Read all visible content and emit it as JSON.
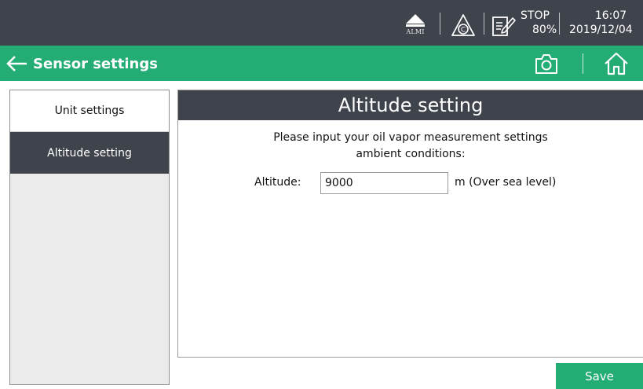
{
  "status_bar": {
    "alarm_label": "ALMI",
    "stop_status": "STOP",
    "stop_percent": "80%",
    "time": "16:07",
    "date": "2019/12/04",
    "icons": [
      "alarm-icon",
      "calibration-icon",
      "stop-document-icon"
    ]
  },
  "title_bar": {
    "title": "Sensor settings",
    "icons": [
      "back-arrow-icon",
      "camera-icon",
      "home-icon"
    ],
    "color": "#23ac74"
  },
  "sidebar": {
    "items": [
      {
        "label": "Unit settings",
        "active": false
      },
      {
        "label": "Altitude setting",
        "active": true
      }
    ]
  },
  "panel": {
    "header": "Altitude setting",
    "description_line1": "Please input your oil vapor measurement settings",
    "description_line2": "ambient conditions:",
    "altitude_label": "Altitude:",
    "altitude_value": "9000",
    "altitude_unit": "m (Over sea level)"
  },
  "actions": {
    "save_label": "Save"
  },
  "colors": {
    "dark": "#3f434c",
    "accent": "#23ac74"
  }
}
